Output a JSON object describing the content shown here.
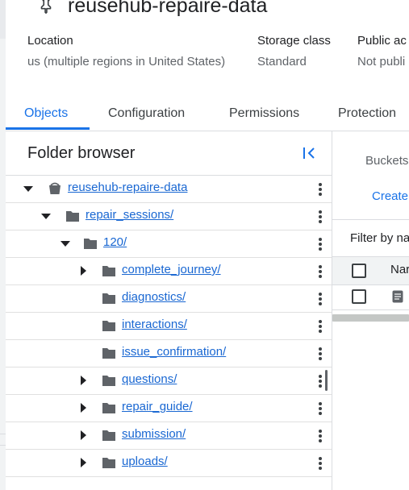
{
  "bucket": {
    "title": "reusehub-repaire-data",
    "details": [
      {
        "label": "Location",
        "value": "us (multiple regions in United States)"
      },
      {
        "label": "Storage class",
        "value": "Standard"
      },
      {
        "label": "Public ac",
        "value": "Not publi"
      }
    ]
  },
  "tabs": [
    {
      "label": "Objects",
      "active": true
    },
    {
      "label": "Configuration",
      "active": false
    },
    {
      "label": "Permissions",
      "active": false
    },
    {
      "label": "Protection",
      "active": false
    }
  ],
  "folder_browser": {
    "title": "Folder browser",
    "items": [
      {
        "label": "reusehub-repaire-data",
        "type": "bucket",
        "chevron": "expanded"
      },
      {
        "label": "repair_sessions/",
        "type": "folder",
        "chevron": "expanded"
      },
      {
        "label": "120/",
        "type": "folder",
        "chevron": "expanded"
      },
      {
        "label": "complete_journey/",
        "type": "folder",
        "chevron": "collapsed"
      },
      {
        "label": "diagnostics/",
        "type": "folder",
        "chevron": "none"
      },
      {
        "label": "interactions/",
        "type": "folder",
        "chevron": "none"
      },
      {
        "label": "issue_confirmation/",
        "type": "folder",
        "chevron": "none"
      },
      {
        "label": "questions/",
        "type": "folder",
        "chevron": "collapsed"
      },
      {
        "label": "repair_guide/",
        "type": "folder",
        "chevron": "collapsed"
      },
      {
        "label": "submission/",
        "type": "folder",
        "chevron": "collapsed"
      },
      {
        "label": "uploads/",
        "type": "folder",
        "chevron": "collapsed"
      }
    ]
  },
  "right_panel": {
    "breadcrumb": "Buckets",
    "create_label": "Create",
    "filter_label": "Filter by na",
    "column_name": "Nar"
  },
  "colors": {
    "accent": "#1a73e8",
    "icon_gray": "#5f6368",
    "divider": "#dadce0"
  }
}
